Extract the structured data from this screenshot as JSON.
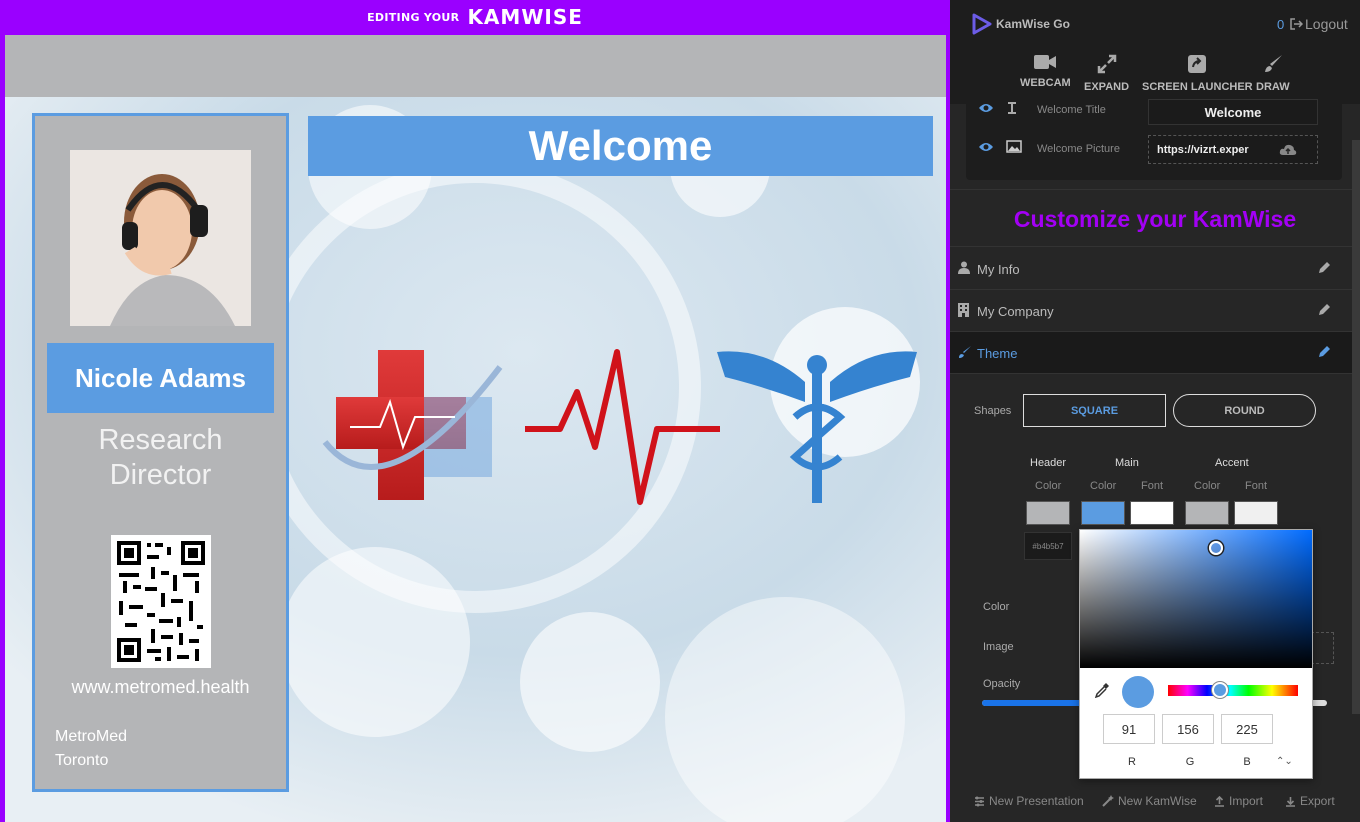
{
  "editor": {
    "banner_small": "EDITING YOUR",
    "banner_brand": "KAMWISE",
    "profile": {
      "name": "Nicole Adams",
      "title_line1": "Research",
      "title_line2": "Director",
      "website": "www.metromed.health",
      "company_line1": "MetroMed",
      "company_line2": "Toronto"
    },
    "welcome": "Welcome"
  },
  "panel": {
    "app_name": "KamWise Go",
    "counter": "0",
    "logout": "Logout",
    "toolbar": [
      {
        "label": "WEBCAM",
        "icon": "webcam-icon"
      },
      {
        "label": "EXPAND",
        "icon": "expand-icon"
      },
      {
        "label": "SCREEN LAUNCHER",
        "icon": "screen-launcher-icon"
      },
      {
        "label": "DRAW",
        "icon": "brush-icon"
      }
    ],
    "fields": [
      {
        "label": "Welcome Title",
        "value": "Welcome"
      },
      {
        "label": "Welcome Picture",
        "value": "https://vizrt.exper"
      }
    ],
    "customize_title": "Customize your KamWise",
    "sections": [
      {
        "label": "My Info",
        "icon": "user-icon"
      },
      {
        "label": "My Company",
        "icon": "building-icon"
      },
      {
        "label": "Theme",
        "icon": "brush-icon"
      }
    ],
    "theme": {
      "shapes_label": "Shapes",
      "square": "SQUARE",
      "round": "ROUND",
      "header": "Header",
      "main": "Main",
      "accent": "Accent",
      "color": "Color",
      "font": "Font",
      "hex": "#b4b5b7",
      "row_color": "Color",
      "row_image": "Image",
      "row_opacity": "Opacity",
      "swatches": {
        "header_color": "#b4b5b7",
        "main_color": "#5b9ce1",
        "main_font": "#ffffff",
        "accent_color": "#b4b5b7",
        "accent_font": "#f0f0f0"
      },
      "opacity": 0.3
    },
    "picker": {
      "r": "91",
      "g": "156",
      "b": "225",
      "r_label": "R",
      "g_label": "G",
      "b_label": "B",
      "toggle": "⌃⌄"
    },
    "footer": {
      "new_presentation": "New Presentation",
      "new_kamwise": "New KamWise",
      "import": "Import",
      "export": "Export"
    }
  }
}
